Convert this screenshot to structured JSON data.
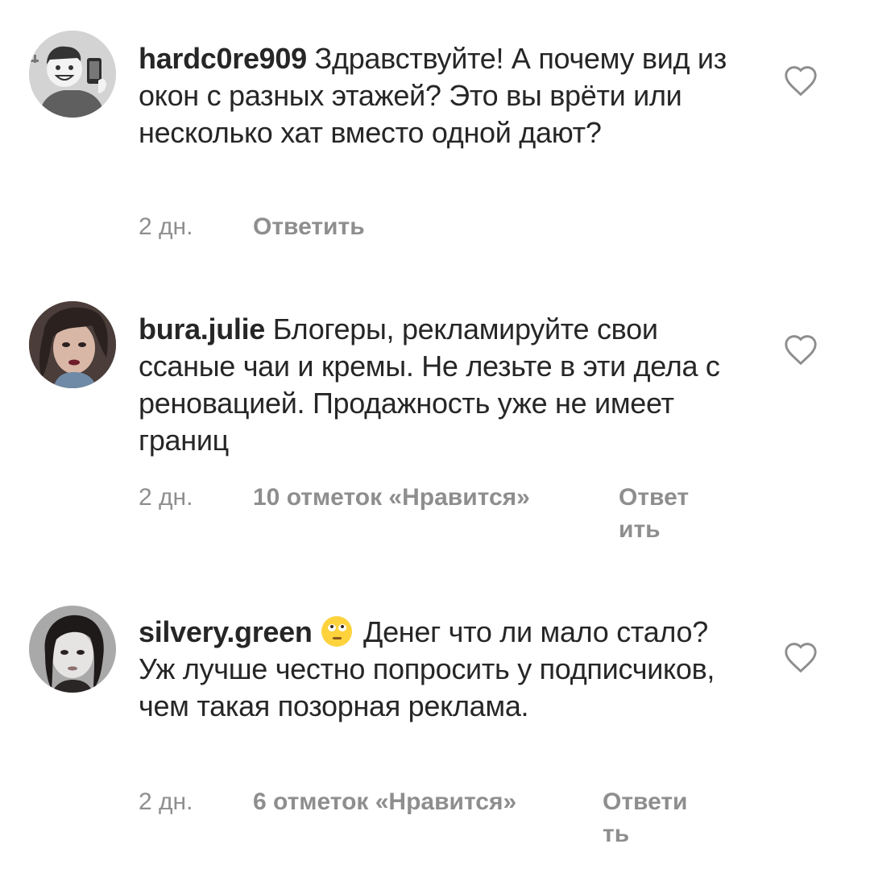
{
  "comments": [
    {
      "username": "hardc0re909",
      "text": " Здравствуйте! А почему вид из окон с разных этажей? Это вы врёти или несколько хат вместо одной дают?",
      "time": "2 дн.",
      "likes": "",
      "reply_label": "Ответить",
      "avatar_icon": "cartoon-man-selfie-avatar"
    },
    {
      "username": "bura.julie",
      "text": " Блогеры, рекламируйте свои ссаные чаи и кремы. Не лезьте в эти дела с реновацией. Продажность уже не имеет границ",
      "time": "2 дн.",
      "likes": "10 отметок «Нравится»",
      "reply_label": "Ответить",
      "avatar_icon": "profile-photo-avatar"
    },
    {
      "username": "silvery.green",
      "emoji": "face-with-rolling-eyes-emoji",
      "text": " Денег что ли мало стало? Уж лучше честно попросить у подписчиков, чем такая позорная реклама.",
      "time": "2 дн.",
      "likes": "6 отметок «Нравится»",
      "reply_label": "Ответить",
      "avatar_icon": "profile-photo-avatar"
    }
  ],
  "icons": {
    "like": "heart-outline-icon"
  },
  "colors": {
    "text": "#262626",
    "meta": "#8e8e8e",
    "background": "#ffffff"
  }
}
